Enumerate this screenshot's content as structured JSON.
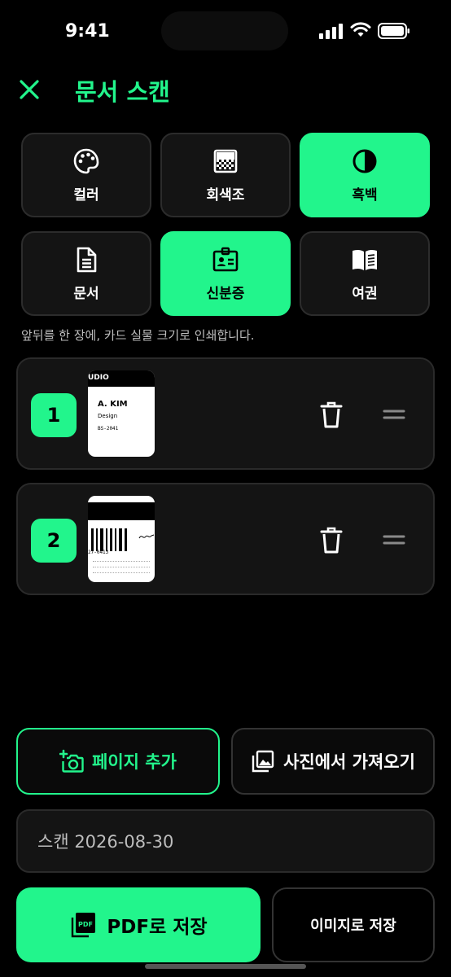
{
  "status_bar": {
    "time": "9:41"
  },
  "header": {
    "title": "문서 스캔"
  },
  "modes": [
    {
      "label": "컬러",
      "icon": "palette-icon",
      "active": false
    },
    {
      "label": "회색조",
      "icon": "grayscale-icon",
      "active": false
    },
    {
      "label": "흑백",
      "icon": "contrast-icon",
      "active": true
    },
    {
      "label": "문서",
      "icon": "document-icon",
      "active": false
    },
    {
      "label": "신분증",
      "icon": "id-card-icon",
      "active": true
    },
    {
      "label": "여권",
      "icon": "passport-book-icon",
      "active": false
    }
  ],
  "hint": "앞뒤를 한 장에, 카드 실물 크기로 인쇄합니다.",
  "pages": [
    {
      "number": "1",
      "thumb": {
        "header": "UDIO",
        "name": "A. KIM",
        "dept": "Design",
        "id": "BS-2041"
      }
    },
    {
      "number": "2",
      "thumb": {
        "code": "27-0413"
      }
    }
  ],
  "actions": {
    "add_page": "페이지 추가",
    "import_photo": "사진에서 가져오기"
  },
  "filename": {
    "value": "스캔 2026-08-30"
  },
  "save": {
    "pdf_label": "PDF로 저장",
    "pdf_icon_text": "PDF",
    "image_label": "이미지로 저장"
  },
  "colors": {
    "accent": "#22f58c",
    "background": "#000000",
    "card": "#141414"
  }
}
